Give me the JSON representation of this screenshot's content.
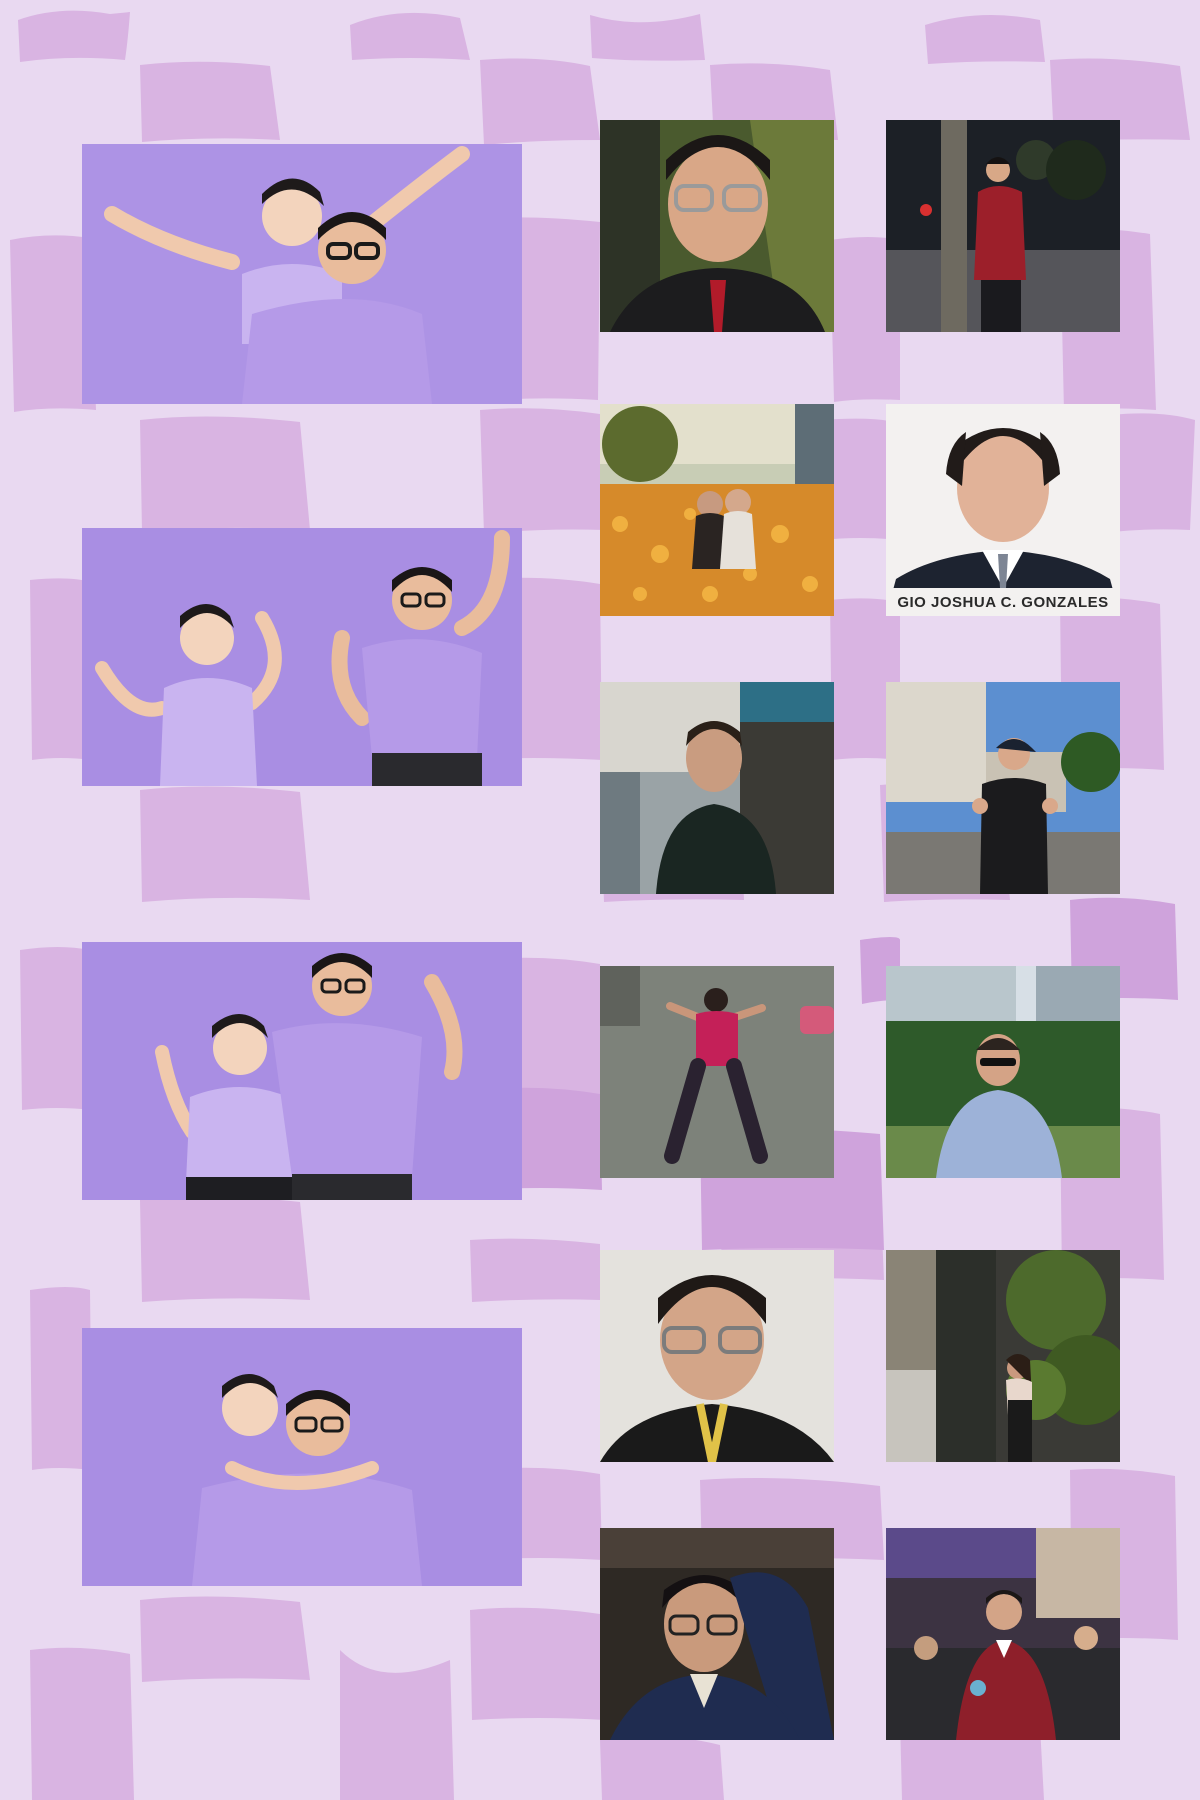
{
  "theme": {
    "background": "#e9d9f1",
    "blob": "#d9b4e2",
    "blob_dark": "#cfa3dc",
    "studio_purple": "#a98ee3",
    "shirt_purple": "#b59ae8"
  },
  "collage": {
    "studio_photos": [
      {
        "name": "studio-photo-piggyback-arms-up"
      },
      {
        "name": "studio-photo-cheering-pair"
      },
      {
        "name": "studio-photo-waving-pair"
      },
      {
        "name": "studio-photo-piggyback-hug"
      }
    ],
    "portrait_photos": [
      {
        "name": "selfie-glasses-red-tie"
      },
      {
        "name": "night-street-red-blazer"
      },
      {
        "name": "flower-field-two-girls"
      },
      {
        "name": "id-photo-formal"
      },
      {
        "name": "street-portrait-dark-shirt"
      },
      {
        "name": "street-thumbs-up-cap"
      },
      {
        "name": "lying-on-ground-pink-shirt"
      },
      {
        "name": "city-sunglasses-patterned-shirt"
      },
      {
        "name": "selfie-glasses-lanyard"
      },
      {
        "name": "night-garden-pose"
      },
      {
        "name": "selfie-hand-on-head"
      },
      {
        "name": "banquet-red-blazer"
      }
    ],
    "id_caption": "GIO JOSHUA C. GONZALES"
  }
}
